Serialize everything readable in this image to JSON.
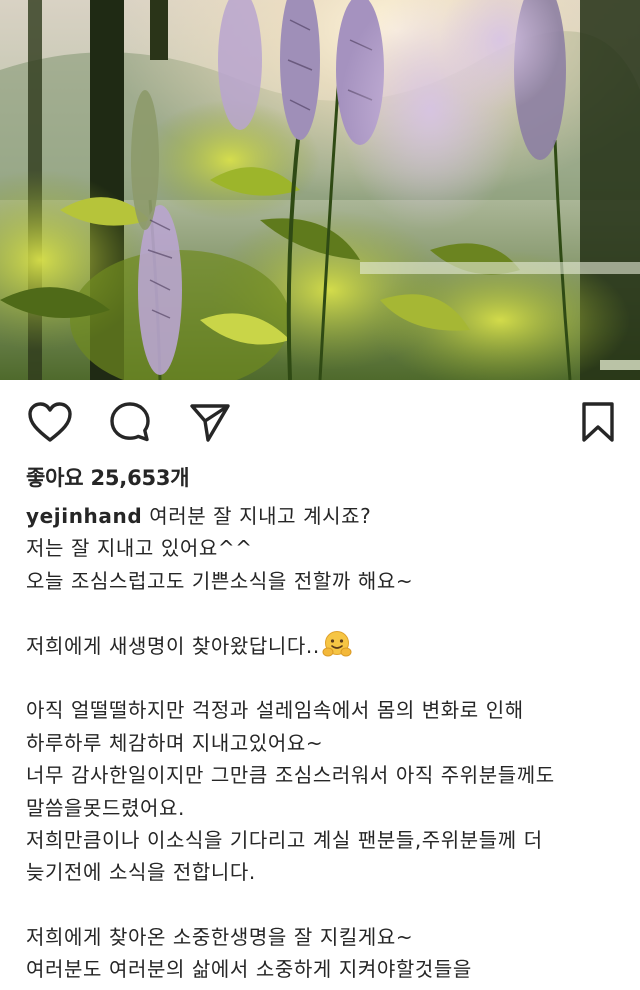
{
  "post": {
    "username": "yejinhand",
    "likes_text": "좋아요 25,653개",
    "caption_lines": [
      "여러분 잘 지내고 계시죠?",
      "저는 잘 지내고 있어요^^",
      "오늘 조심스럽고도 기쁜소식을 전할까 해요~",
      "",
      "저희에게 새생명이 찾아왔답니다..",
      "",
      "아직 얼떨떨하지만 걱정과 설레임속에서 몸의 변화로 인해",
      "하루하루 체감하며 지내고있어요~",
      "너무 감사한일이지만 그만큼 조심스러워서 아직 주위분들께도",
      "말씀을못드렸어요.",
      "저희만큼이나 이소식을 기다리고 계실 팬분들,주위분들께 더",
      "늦기전에 소식을 전합니다.",
      "",
      "저희에게 찾아온 소중한생명을 잘 지킬게요~",
      "여러분도 여러분의 삶에서 소중하게 지켜야할것들을"
    ],
    "emoji_icon": "hugging-face-emoji"
  },
  "actions": {
    "like_icon": "heart-icon",
    "comment_icon": "comment-bubble-icon",
    "share_icon": "paper-plane-icon",
    "save_icon": "bookmark-icon"
  },
  "image": {
    "subject": "purple-flower-spikes-garden-photo"
  }
}
